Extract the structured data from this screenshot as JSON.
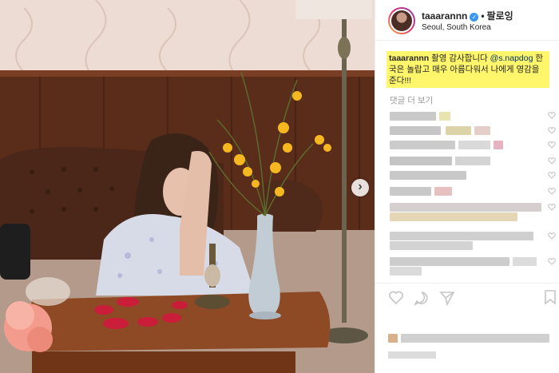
{
  "post": {
    "username": "taaarannn",
    "dot": "•",
    "follow_label": "팔로잉",
    "location": "Seoul, South Korea"
  },
  "caption": {
    "username": "taaarannn",
    "text_before": " 촬영 감사합니다 ",
    "mention": "@s.napdog",
    "text_after": " 한국은 놀랍고 매우 아름다워서 나에게 영감을 준다!!!"
  },
  "comments": {
    "view_more_label": "댓글 더 보기"
  },
  "colors": {
    "caption_highlight": "#fff66b",
    "verified_badge": "#3897f0",
    "mention": "#003569"
  },
  "icons": [
    "verified-badge-icon",
    "next-arrow-icon",
    "heart-icon",
    "comment-icon",
    "share-icon",
    "bookmark-icon"
  ]
}
